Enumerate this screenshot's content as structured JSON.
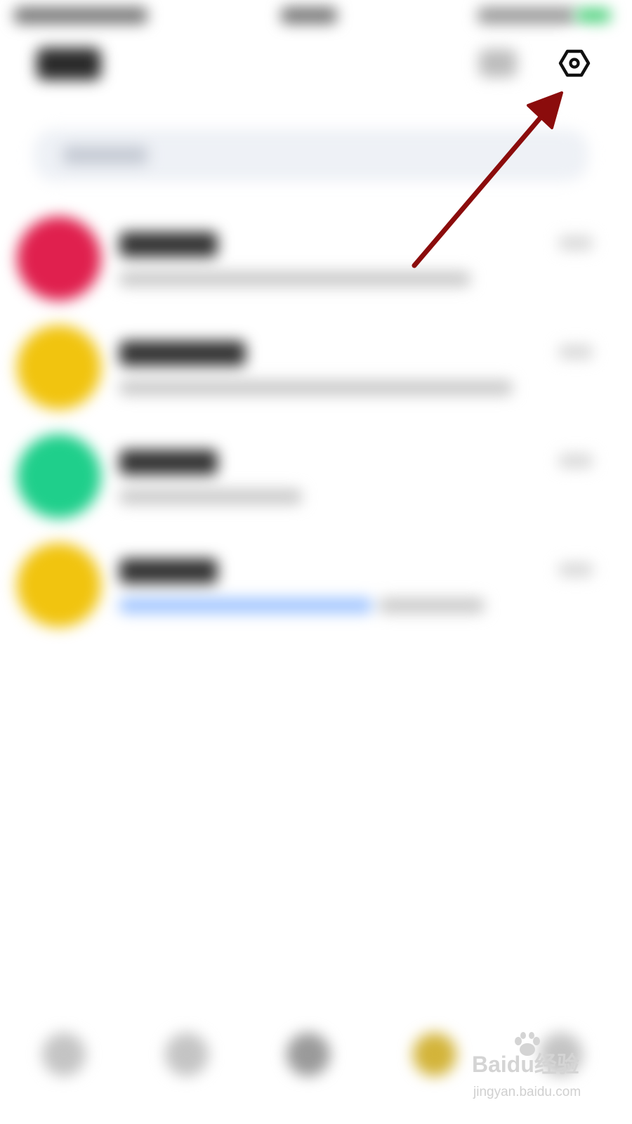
{
  "settings_icon": "settings-hexagon-icon",
  "chat_rows": [
    {
      "avatar_color": "#e0204e"
    },
    {
      "avatar_color": "#f1c40f"
    },
    {
      "avatar_color": "#1fcf8b"
    },
    {
      "avatar_color": "#f1c40f"
    }
  ],
  "annotation": {
    "arrow_color": "#8b0c0c"
  },
  "watermark": {
    "brand": "Baidu经验",
    "url": "jingyan.baidu.com"
  }
}
